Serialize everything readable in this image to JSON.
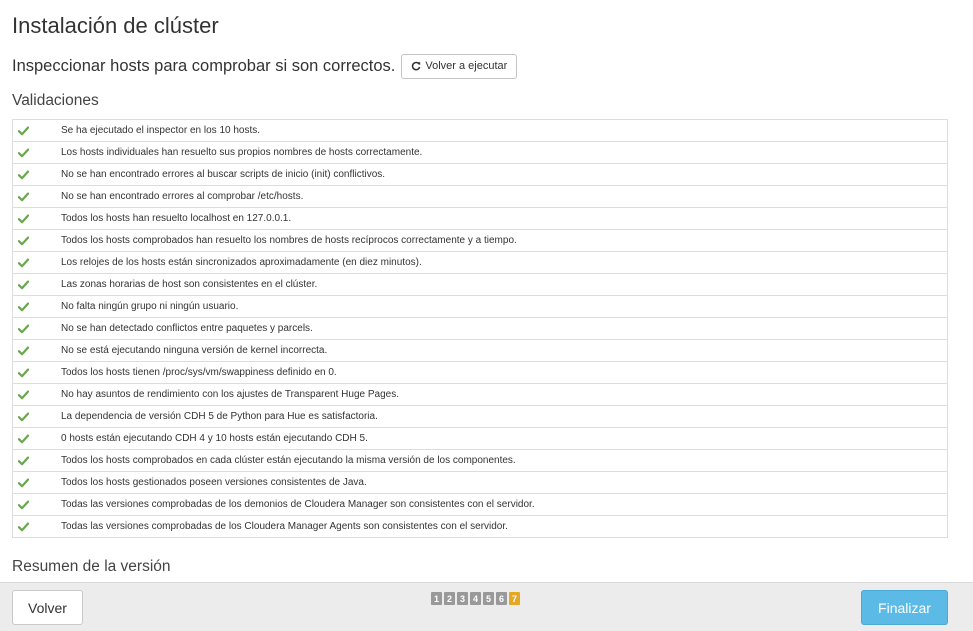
{
  "page": {
    "title": "Instalación de clúster",
    "inspect_text": "Inspeccionar hosts para comprobar si son correctos.",
    "rerun_label": "Volver a ejecutar",
    "validations_title": "Validaciones",
    "summary_title": "Resumen de la versión"
  },
  "validations": [
    {
      "status": "check-icon",
      "text": "Se ha ejecutado el inspector en los 10 hosts."
    },
    {
      "status": "check-icon",
      "text": "Los hosts individuales han resuelto sus propios nombres de hosts correctamente."
    },
    {
      "status": "check-icon",
      "text": "No se han encontrado errores al buscar scripts de inicio (init) conflictivos."
    },
    {
      "status": "check-icon",
      "text": "No se han encontrado errores al comprobar /etc/hosts."
    },
    {
      "status": "check-icon",
      "text": "Todos los hosts han resuelto localhost en 127.0.0.1."
    },
    {
      "status": "check-icon",
      "text": "Todos los hosts comprobados han resuelto los nombres de hosts recíprocos correctamente y a tiempo."
    },
    {
      "status": "check-icon",
      "text": "Los relojes de los hosts están sincronizados aproximadamente (en diez minutos)."
    },
    {
      "status": "check-icon",
      "text": "Las zonas horarias de host son consistentes en el clúster."
    },
    {
      "status": "check-icon",
      "text": "No falta ningún grupo ni ningún usuario."
    },
    {
      "status": "check-icon",
      "text": "No se han detectado conflictos entre paquetes y parcels."
    },
    {
      "status": "check-icon",
      "text": "No se está ejecutando ninguna versión de kernel incorrecta."
    },
    {
      "status": "check-icon",
      "text": "Todos los hosts tienen /proc/sys/vm/swappiness definido en 0."
    },
    {
      "status": "check-icon",
      "text": "No hay asuntos de rendimiento con los ajustes de Transparent Huge Pages."
    },
    {
      "status": "check-icon",
      "text": "La dependencia de versión CDH 5 de Python para Hue es satisfactoria."
    },
    {
      "status": "check-icon",
      "text": "0 hosts están ejecutando CDH 4 y 10 hosts están ejecutando CDH 5."
    },
    {
      "status": "check-icon",
      "text": "Todos los hosts comprobados en cada clúster están ejecutando la misma versión de los componentes."
    },
    {
      "status": "check-icon",
      "text": "Todos los hosts gestionados poseen versiones consistentes de Java."
    },
    {
      "status": "check-icon",
      "text": "Todas las versiones comprobadas de los demonios de Cloudera Manager son consistentes con el servidor."
    },
    {
      "status": "check-icon",
      "text": "Todas las versiones comprobadas de los Cloudera Manager Agents son consistentes con el servidor."
    }
  ],
  "footer": {
    "back_label": "Volver",
    "finish_label": "Finalizar",
    "steps": [
      "1",
      "2",
      "3",
      "4",
      "5",
      "6",
      "7"
    ],
    "active_step": "7"
  },
  "colors": {
    "check": "#6aa84f",
    "finish_button": "#5bbbe6",
    "active_step": "#e5a823",
    "inactive_step": "#999999"
  }
}
